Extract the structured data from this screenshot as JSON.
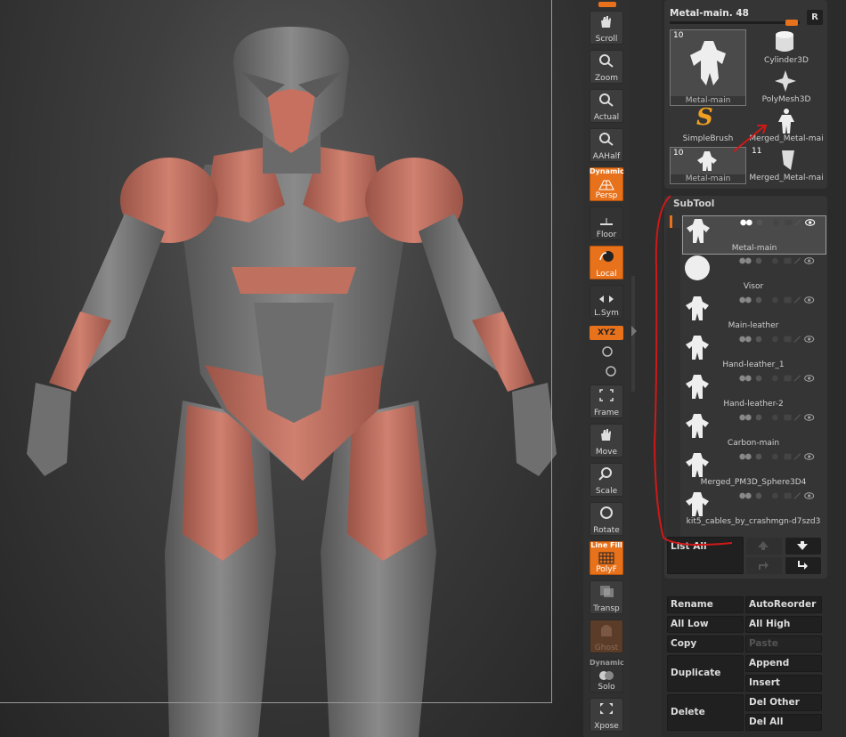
{
  "toolbar": {
    "buttons": [
      {
        "label": "Scroll"
      },
      {
        "label": "Zoom"
      },
      {
        "label": "Actual"
      },
      {
        "label": "AAHalf"
      },
      {
        "label": "Persp",
        "top": "Dynamic"
      },
      {
        "label": "Floor"
      },
      {
        "label": "Local"
      },
      {
        "label": "L.Sym"
      },
      {
        "label": "Frame"
      },
      {
        "label": "Move"
      },
      {
        "label": "Scale"
      },
      {
        "label": "Rotate"
      },
      {
        "label": "PolyF",
        "top": "Line Fill"
      },
      {
        "label": "Transp"
      },
      {
        "label": "Ghost"
      },
      {
        "label": "Solo",
        "top": "Dynamic"
      },
      {
        "label": "Xpose"
      }
    ],
    "xyz_label": "XYZ"
  },
  "tool_palette": {
    "current_tool": "Metal-main. 48",
    "r_button": "R",
    "items": [
      {
        "caption": "Metal-main",
        "num": "10"
      },
      {
        "caption": "Cylinder3D"
      },
      {
        "caption": "PolyMesh3D"
      },
      {
        "caption": "SimpleBrush"
      },
      {
        "caption": "Merged_Metal-mai"
      },
      {
        "caption": "Metal-main",
        "num": "10"
      },
      {
        "caption": "Merged_Metal-mai",
        "num": "11"
      }
    ]
  },
  "subtool": {
    "header": "SubTool",
    "rows": [
      {
        "name": "Metal-main"
      },
      {
        "name": "Visor"
      },
      {
        "name": "Main-leather"
      },
      {
        "name": "Hand-leather_1"
      },
      {
        "name": "Hand-leather-2"
      },
      {
        "name": "Carbon-main"
      },
      {
        "name": "Merged_PM3D_Sphere3D4"
      },
      {
        "name": "kit5_cables_by_crashmgn-d7szd3"
      }
    ],
    "list_all": "List All",
    "actions": {
      "rename": "Rename",
      "autoreorder": "AutoReorder",
      "all_low": "All Low",
      "all_high": "All High",
      "copy": "Copy",
      "paste": "Paste",
      "duplicate": "Duplicate",
      "append": "Append",
      "insert": "Insert",
      "delete": "Delete",
      "del_other": "Del Other",
      "del_all": "Del All"
    }
  },
  "colors": {
    "accent": "#e8721c",
    "armor_red": "#c8705f",
    "armor_grey": "#7b7b7b"
  }
}
